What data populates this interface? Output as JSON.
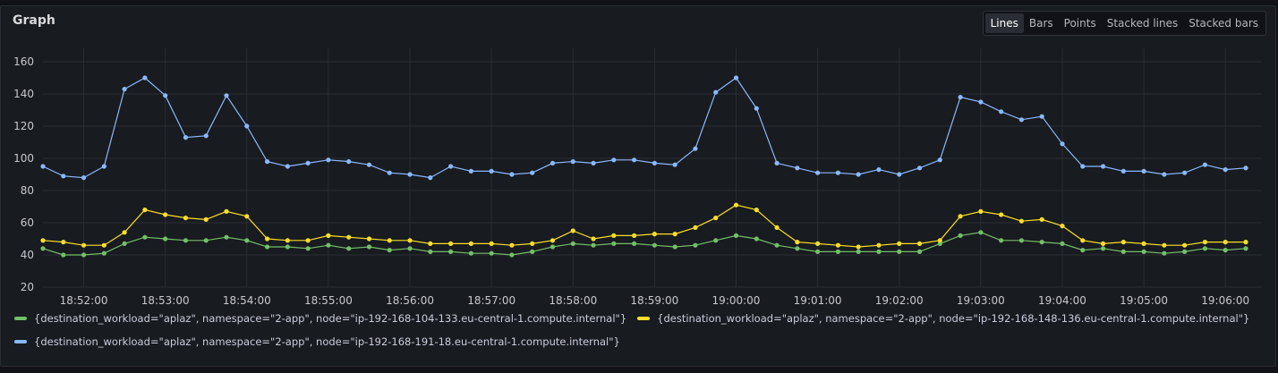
{
  "panel": {
    "title": "Graph"
  },
  "view_modes": [
    "Lines",
    "Bars",
    "Points",
    "Stacked lines",
    "Stacked bars"
  ],
  "active_view": "Lines",
  "chart_data": {
    "type": "line",
    "x": [
      "18:51:30",
      "18:51:45",
      "18:52:00",
      "18:52:15",
      "18:52:30",
      "18:52:45",
      "18:53:00",
      "18:53:15",
      "18:53:30",
      "18:53:45",
      "18:54:00",
      "18:54:15",
      "18:54:30",
      "18:54:45",
      "18:55:00",
      "18:55:15",
      "18:55:30",
      "18:55:45",
      "18:56:00",
      "18:56:15",
      "18:56:30",
      "18:56:45",
      "18:57:00",
      "18:57:15",
      "18:57:30",
      "18:57:45",
      "18:58:00",
      "18:58:15",
      "18:58:30",
      "18:58:45",
      "18:59:00",
      "18:59:15",
      "18:59:30",
      "18:59:45",
      "19:00:00",
      "19:00:15",
      "19:00:30",
      "19:00:45",
      "19:01:00",
      "19:01:15",
      "19:01:30",
      "19:01:45",
      "19:02:00",
      "19:02:15",
      "19:02:30",
      "19:02:45",
      "19:03:00",
      "19:03:15",
      "19:03:30",
      "19:03:45",
      "19:04:00",
      "19:04:15",
      "19:04:30",
      "19:04:45",
      "19:05:00",
      "19:05:15",
      "19:05:30",
      "19:05:45",
      "19:06:00",
      "19:06:15"
    ],
    "x_ticks": [
      "18:52:00",
      "18:53:00",
      "18:54:00",
      "18:55:00",
      "18:56:00",
      "18:57:00",
      "18:58:00",
      "18:59:00",
      "19:00:00",
      "19:01:00",
      "19:02:00",
      "19:03:00",
      "19:04:00",
      "19:05:00",
      "19:06:00"
    ],
    "y_ticks": [
      20,
      40,
      60,
      80,
      100,
      120,
      140,
      160
    ],
    "ylim": [
      20,
      165
    ],
    "grid": true,
    "legend_position": "bottom",
    "series": [
      {
        "name": "{destination_workload=\"aplaz\", namespace=\"2-app\", node=\"ip-192-168-104-133.eu-central-1.compute.internal\"}",
        "color": "#73bf69",
        "values": [
          44,
          40,
          40,
          41,
          47,
          51,
          50,
          49,
          49,
          51,
          49,
          45,
          45,
          44,
          46,
          44,
          45,
          43,
          44,
          42,
          42,
          41,
          41,
          40,
          42,
          45,
          47,
          46,
          47,
          47,
          46,
          45,
          46,
          49,
          52,
          50,
          46,
          44,
          42,
          42,
          42,
          42,
          42,
          42,
          47,
          52,
          54,
          49,
          49,
          48,
          47,
          43,
          44,
          42,
          42,
          41,
          42,
          44,
          43,
          44
        ]
      },
      {
        "name": "{destination_workload=\"aplaz\", namespace=\"2-app\", node=\"ip-192-168-148-136.eu-central-1.compute.internal\"}",
        "color": "#fade2a",
        "values": [
          49,
          48,
          46,
          46,
          54,
          68,
          65,
          63,
          62,
          67,
          64,
          50,
          49,
          49,
          52,
          51,
          50,
          49,
          49,
          47,
          47,
          47,
          47,
          46,
          47,
          49,
          55,
          50,
          52,
          52,
          53,
          53,
          57,
          63,
          71,
          68,
          57,
          48,
          47,
          46,
          45,
          46,
          47,
          47,
          49,
          64,
          67,
          65,
          61,
          62,
          58,
          49,
          47,
          48,
          47,
          46,
          46,
          48,
          48,
          48
        ]
      },
      {
        "name": "{destination_workload=\"aplaz\", namespace=\"2-app\", node=\"ip-192-168-191-18.eu-central-1.compute.internal\"}",
        "color": "#8ab8ff",
        "values": [
          95,
          89,
          88,
          95,
          143,
          150,
          139,
          113,
          114,
          139,
          120,
          98,
          95,
          97,
          99,
          98,
          96,
          91,
          90,
          88,
          95,
          92,
          92,
          90,
          91,
          97,
          98,
          97,
          99,
          99,
          97,
          96,
          106,
          141,
          150,
          131,
          97,
          94,
          91,
          91,
          90,
          93,
          90,
          94,
          99,
          138,
          135,
          129,
          124,
          126,
          109,
          95,
          95,
          92,
          92,
          90,
          91,
          96,
          93,
          94
        ]
      }
    ]
  }
}
